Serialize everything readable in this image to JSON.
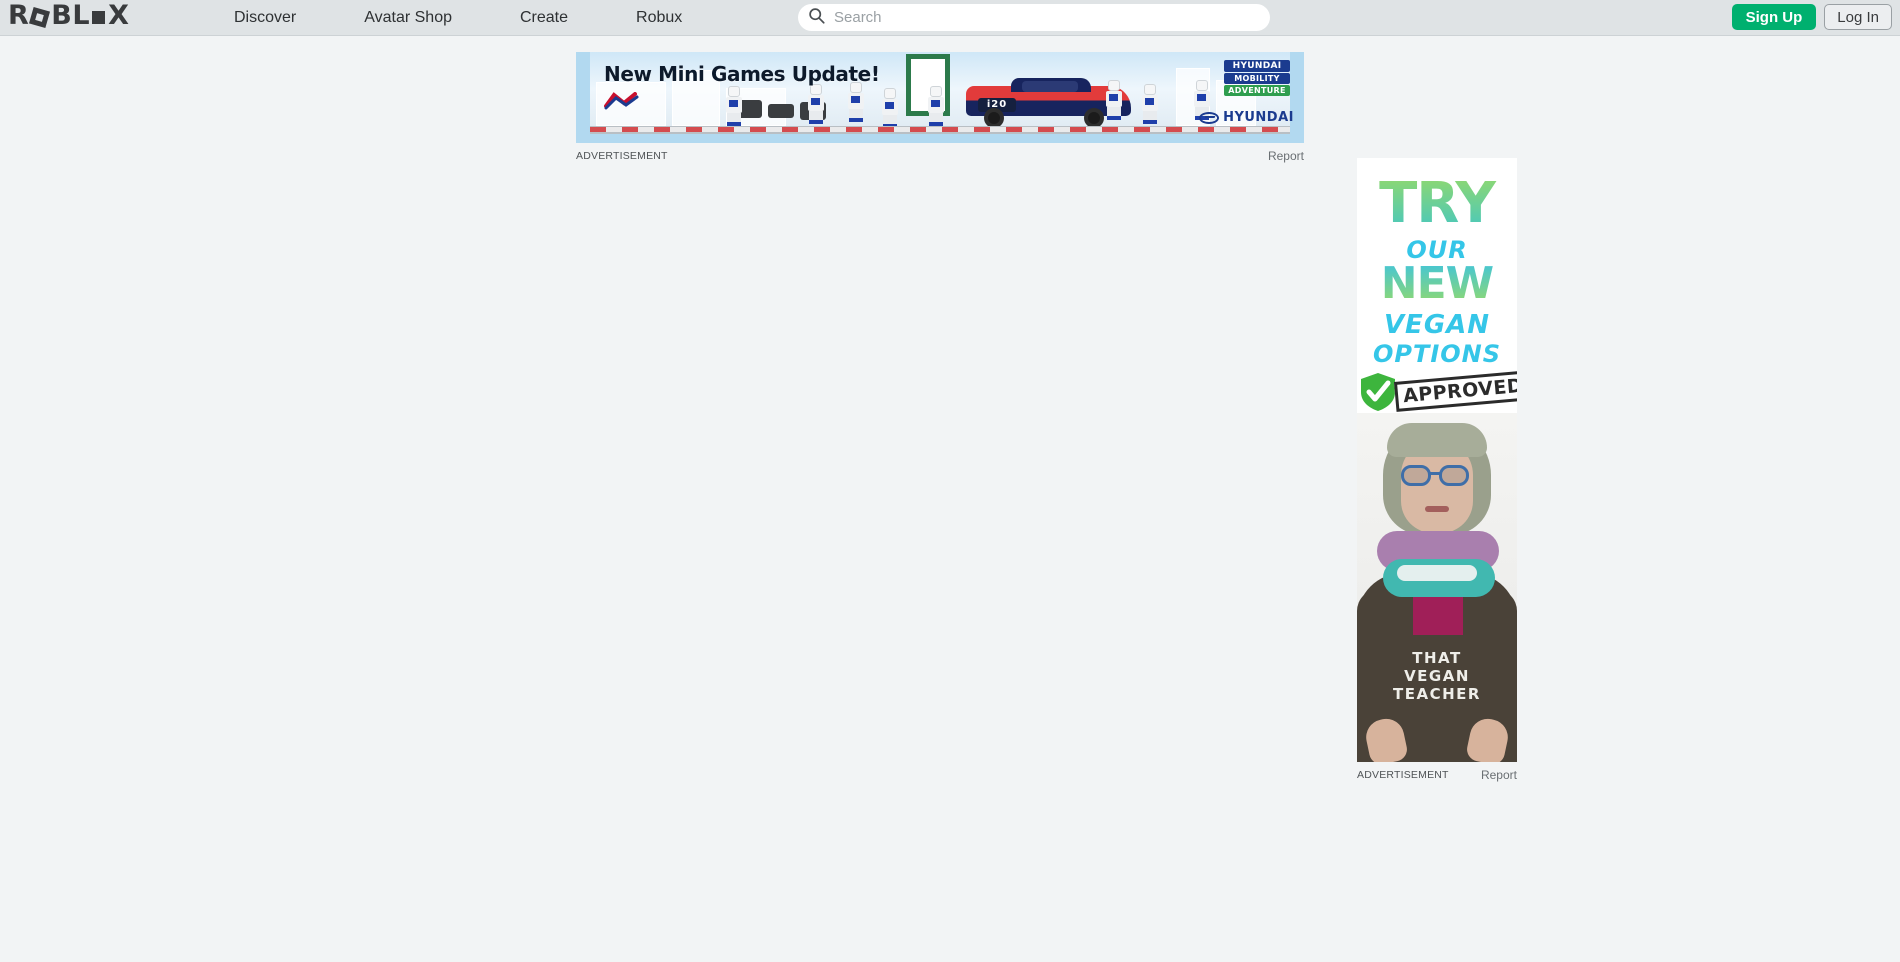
{
  "header": {
    "logo_text": "ROBLOX",
    "nav": [
      {
        "label": "Discover"
      },
      {
        "label": "Avatar Shop"
      },
      {
        "label": "Create"
      },
      {
        "label": "Robux"
      }
    ],
    "search": {
      "placeholder": "Search",
      "value": "",
      "icon": "search-icon"
    },
    "signup_label": "Sign Up",
    "login_label": "Log In",
    "background_color": "#dfe3e5",
    "accent_green": "#00b06f"
  },
  "banner_ad": {
    "headline": "New Mini Games Update!",
    "brand_badge_line1": "HYUNDAI",
    "brand_badge_line2": "MOBILITY",
    "brand_badge_line3": "ADVENTURE",
    "brand_name": "HYUNDAI",
    "car_number": "i20",
    "background_color": "#b2d9f0",
    "label": "ADVERTISEMENT",
    "report_label": "Report"
  },
  "vertical_ad": {
    "line_try": "TRY",
    "line_our": "OUR",
    "line_new": "NEW",
    "line_vegan": "VEGAN",
    "line_options": "OPTIONS",
    "stamp": "APPROVED",
    "shirt_text": "THAT\nVEGAN\nTEACHER",
    "shirt_line1": "THAT",
    "shirt_line2": "VEGAN",
    "shirt_line3": "TEACHER",
    "label": "ADVERTISEMENT",
    "report_label": "Report",
    "accent_cyan": "#35c6e8",
    "accent_green": "#8fd870"
  },
  "page": {
    "background_color": "#f2f4f5"
  }
}
